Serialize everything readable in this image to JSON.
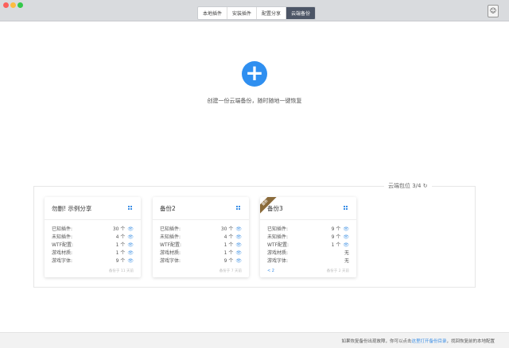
{
  "window": {
    "colors": {
      "close": "#fc605c",
      "minimize": "#fdbc40",
      "maximize": "#34c84a"
    }
  },
  "tabs": [
    {
      "label": "本地插件"
    },
    {
      "label": "安装插件"
    },
    {
      "label": "配置分享"
    },
    {
      "label": "云端备份",
      "active": true
    }
  ],
  "main": {
    "create_hint": "创建一份云端备份，随时随地一键恢复",
    "quota": "云端包位 3/4"
  },
  "cards": [
    {
      "title": "勿删! 示例分享",
      "rows": [
        {
          "label": "已知插件:",
          "value": "30 个"
        },
        {
          "label": "未知插件:",
          "value": "4 个"
        },
        {
          "label": "WTF配置:",
          "value": "1 个"
        },
        {
          "label": "游戏材质:",
          "value": "1 个"
        },
        {
          "label": "游戏字体:",
          "value": "9 个"
        }
      ],
      "footer": "备份于 11 天前"
    },
    {
      "title": "备份2",
      "rows": [
        {
          "label": "已知插件:",
          "value": "30 个"
        },
        {
          "label": "未知插件:",
          "value": "4 个"
        },
        {
          "label": "WTF配置:",
          "value": "1 个"
        },
        {
          "label": "游戏材质:",
          "value": "1 个"
        },
        {
          "label": "游戏字体:",
          "value": "9 个"
        }
      ],
      "footer": "备份于 7 天前"
    },
    {
      "title": "备份3",
      "ribbon": "最新",
      "share": "< 2",
      "rows": [
        {
          "label": "已知插件:",
          "value": "9 个"
        },
        {
          "label": "未知插件:",
          "value": "9 个"
        },
        {
          "label": "WTF配置:",
          "value": "1 个"
        },
        {
          "label": "游戏材质:",
          "value": "无"
        },
        {
          "label": "游戏字体:",
          "value": "无"
        }
      ],
      "footer": "备份于 2 天前"
    }
  ],
  "footer": {
    "text_before": "如果恢复备份出现故障，你可以点击",
    "link": "这里打开备份目录",
    "text_after": "，找回恢复前的本地配置"
  }
}
